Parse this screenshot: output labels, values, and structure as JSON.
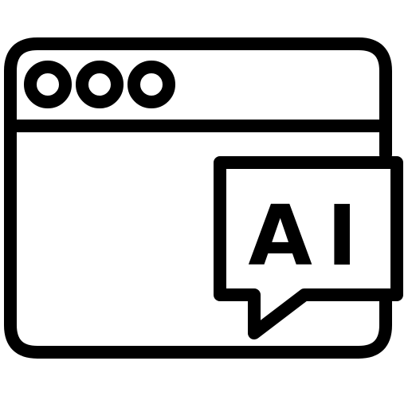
{
  "icon": {
    "name": "browser-window-ai-chat-icon",
    "stroke_color": "#000000",
    "background_color": "#ffffff"
  },
  "window": {
    "titlebar_dots": [
      "dot",
      "dot",
      "dot"
    ]
  },
  "bubble": {
    "text": "AI"
  }
}
